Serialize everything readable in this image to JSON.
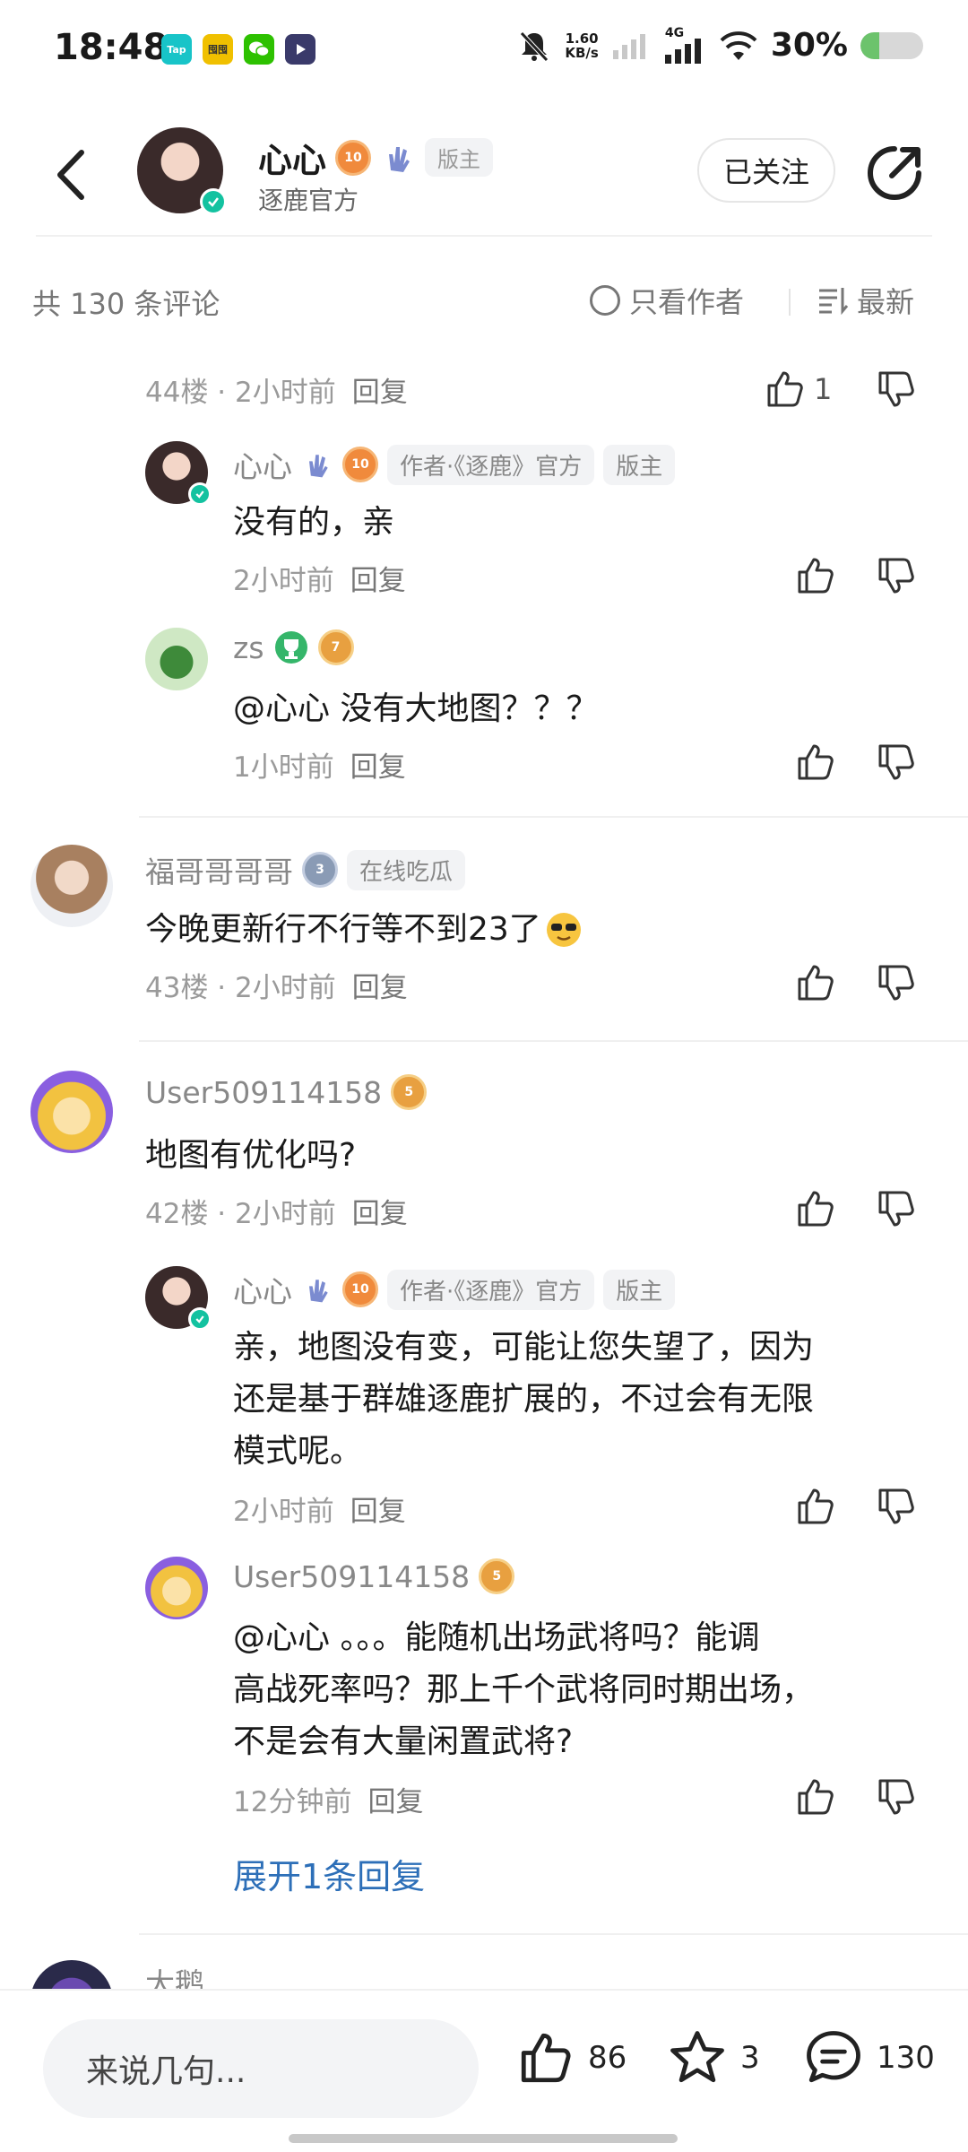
{
  "status_bar": {
    "time": "18:48",
    "app_icons": [
      {
        "name": "taptap-icon",
        "label": "Tap",
        "color": "#18c4c8"
      },
      {
        "name": "yellow-app-icon",
        "label": "囤囤",
        "color": "#f0c000"
      },
      {
        "name": "wechat-icon",
        "label": "",
        "color": "#2dc100"
      },
      {
        "name": "media-app-icon",
        "label": "",
        "color": "#3a3a6a"
      }
    ],
    "net_speed_value": "1.60",
    "net_speed_unit": "KB/s",
    "network": "4G",
    "battery": "30%",
    "battery_level": 0.3
  },
  "header": {
    "author_name": "心心",
    "level_badge": "10",
    "role_tag": "版主",
    "subtitle": "逐鹿官方",
    "follow_label": "已关注"
  },
  "filter_bar": {
    "count_label": "共 130 条评论",
    "only_author_label": "只看作者",
    "sort_label": "最新"
  },
  "comments": {
    "top_meta": {
      "floor": "44楼",
      "time": "2小时前",
      "reply": "回复",
      "likes": "1"
    },
    "r1": {
      "name": "心心",
      "level": "10",
      "tag1": "作者·《逐鹿》官方",
      "tag2": "版主",
      "text": "没有的，亲",
      "time": "2小时前",
      "reply": "回复"
    },
    "r2": {
      "name": "zs",
      "level": "7",
      "text": "@心心  没有大地图？？？",
      "time": "1小时前",
      "reply": "回复"
    },
    "c43": {
      "name": "福哥哥哥哥",
      "level": "3",
      "tag": "在线吃瓜",
      "text": "今晚更新行不行等不到23了",
      "floor": "43楼",
      "time": "2小时前",
      "reply": "回复"
    },
    "c42": {
      "name": "User509114158",
      "level": "5",
      "text": "地图有优化吗?",
      "floor": "42楼",
      "time": "2小时前",
      "reply": "回复"
    },
    "r3": {
      "name": "心心",
      "level": "10",
      "tag1": "作者·《逐鹿》官方",
      "tag2": "版主",
      "line1": "亲，地图没有变，可能让您失望了，因为",
      "line2": "还是基于群雄逐鹿扩展的，不过会有无限",
      "line3": "模式呢。",
      "time": "2小时前",
      "reply": "回复"
    },
    "r4": {
      "name": "User509114158",
      "level": "5",
      "line1": "@心心  。。。能随机出场武将吗？能调",
      "line2": "高战死率吗？那上千个武将同时期出场，",
      "line3": "不是会有大量闲置武将?",
      "time": "12分钟前",
      "reply": "回复"
    },
    "expand_label": "展开1条回复",
    "partial_name": "大鹅"
  },
  "bottom_bar": {
    "input_placeholder": "来说几句...",
    "likes": "86",
    "stars": "3",
    "comments": "130"
  },
  "colors": {
    "accent_blue": "#2d6fb8",
    "verify_green": "#13c2a0",
    "level_orange": "#f08a3c"
  }
}
